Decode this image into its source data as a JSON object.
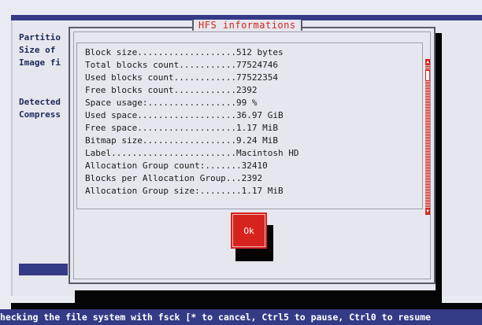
{
  "background": {
    "lines": [
      "Partitio",
      "Size of ",
      "Image fi",
      "Detected",
      "Compress"
    ]
  },
  "dialog": {
    "title": "HFS informations",
    "rows": [
      "Block size...................512 bytes",
      "Total blocks count...........77524746",
      "Used blocks count............77522354",
      "Free blocks count............2392",
      "Space usage:.................99 %",
      "Used space...................36.97 GiB",
      "Free space...................1.17 MiB",
      "Bitmap size..................9.24 MiB",
      "Label........................Macintosh HD",
      "Allocation Group count:.......32410",
      "Blocks per Allocation Group...2392",
      "Allocation Group size:........1.17 MiB"
    ],
    "ok_label": "Ok"
  },
  "status_bar": {
    "text": "hecking the file system with fsck [* to cancel, Ctrl5 to pause, Ctrl0 to resume"
  },
  "colors": {
    "accent": "#d6231e",
    "navy": "#343a86",
    "text": "#1d2a5a",
    "background": "#e9ebf2"
  },
  "icons": {
    "scroll_up": "arrow-up-icon",
    "scroll_down": "arrow-down-icon"
  }
}
